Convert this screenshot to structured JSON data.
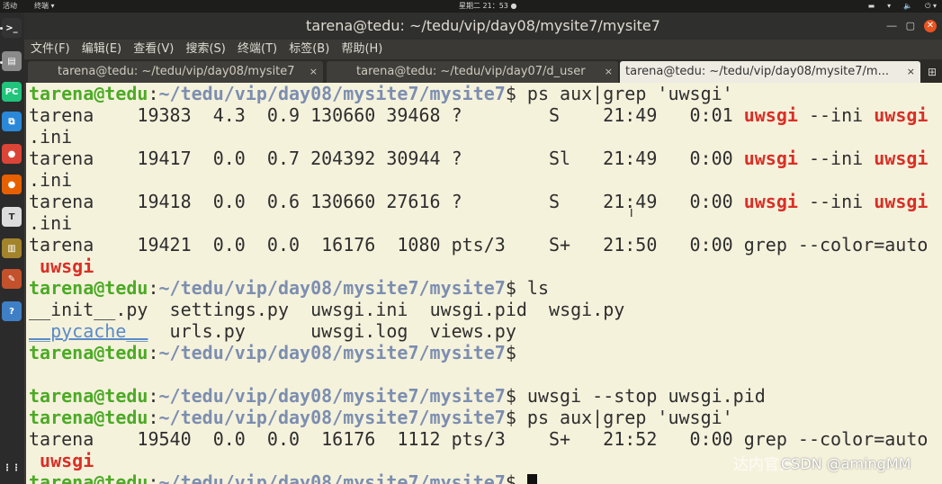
{
  "topbar": {
    "activities": "活动",
    "app_menu": "终端 ▾",
    "clock": "星期二 21：53 ●",
    "tray": [
      "▬",
      "▾",
      "🔈",
      "⏻ ▾"
    ]
  },
  "launcher": {
    "items": [
      {
        "name": "terminal-app-icon",
        "glyph": ">_",
        "color": "#333333"
      },
      {
        "name": "files-app-icon",
        "glyph": "▤",
        "color": "#8a8a8a"
      },
      {
        "name": "pycharm-app-icon",
        "glyph": "PC",
        "color": "#21c47b"
      },
      {
        "name": "vscode-app-icon",
        "glyph": "⧉",
        "color": "#2b88d8"
      },
      {
        "name": "chrome-app-icon",
        "glyph": "●",
        "color": "#db4437"
      },
      {
        "name": "firefox-app-icon",
        "glyph": "●",
        "color": "#e66000"
      },
      {
        "name": "typora-app-icon",
        "glyph": "T",
        "color": "#dddddd"
      },
      {
        "name": "book-app-icon",
        "glyph": "▥",
        "color": "#a3842b"
      },
      {
        "name": "tools-app-icon",
        "glyph": "✎",
        "color": "#c3512c"
      },
      {
        "name": "help-app-icon",
        "glyph": "?",
        "color": "#3f7fc6"
      },
      {
        "name": "app-grid-icon",
        "glyph": "⋮⋮",
        "color": "#2b2b2b"
      }
    ]
  },
  "window": {
    "title": "tarena@tedu: ~/tedu/vip/day08/mysite7/mysite7",
    "menu": [
      "文件(F)",
      "编辑(E)",
      "查看(V)",
      "搜索(S)",
      "终端(T)",
      "标签(B)",
      "帮助(H)"
    ],
    "tabs": [
      {
        "label": "tarena@tedu: ~/tedu/vip/day08/mysite7",
        "close": "×"
      },
      {
        "label": "tarena@tedu: ~/tedu/vip/day07/d_user",
        "close": "×"
      },
      {
        "label": "tarena@tedu: ~/tedu/vip/day08/mysite7/m...",
        "close": "×"
      }
    ],
    "new_tab": "⊞"
  },
  "terminal": {
    "user": "tarena@tedu",
    "path": "~/tedu/vip/day08/mysite7/mysite7",
    "cmd1": "ps aux|grep 'uwsgi'",
    "rows1": [
      {
        "pre": "tarena    19383  4.3  0.9 130660 39468 ?        S    21:49   0:01 ",
        "prog": "uwsgi",
        "mid": " --ini ",
        "file": "uwsgi",
        "ext": ".ini"
      },
      {
        "pre": "tarena    19417  0.0  0.7 204392 30944 ?        Sl   21:49   0:00 ",
        "prog": "uwsgi",
        "mid": " --ini ",
        "file": "uwsgi",
        "ext": ".ini"
      },
      {
        "pre": "tarena    19418  0.0  0.6 130660 27616 ?        S    21:49   0:00 ",
        "prog": "uwsgi",
        "mid": " --ini ",
        "file": "uwsgi",
        "ext": ".ini"
      },
      {
        "pre": "tarena    19421  0.0  0.0  16176  1080 pts/3    S+   21:50   0:00 grep --color=auto",
        "tail": "uwsgi"
      }
    ],
    "cmd2": "ls",
    "ls": {
      "init": "__init__.py",
      "settings": "settings.py",
      "ini": "uwsgi.ini",
      "pid": "uwsgi.pid",
      "wsgi": "wsgi.py",
      "pycache": "__pycache__",
      "urls": "urls.py",
      "log": "uwsgi.log",
      "views": "views.py"
    },
    "cmd3": "uwsgi --stop uwsgi.pid",
    "cmd4": "ps aux|grep 'uwsgi'",
    "rows2": [
      {
        "pre": "tarena    19540  0.0  0.0  16176  1112 pts/3    S+   21:52   0:00 grep --color=auto",
        "tail": "uwsgi"
      }
    ]
  },
  "overlay": {
    "watermark": "CSDN @amingMM",
    "ghost": "达内官方"
  }
}
